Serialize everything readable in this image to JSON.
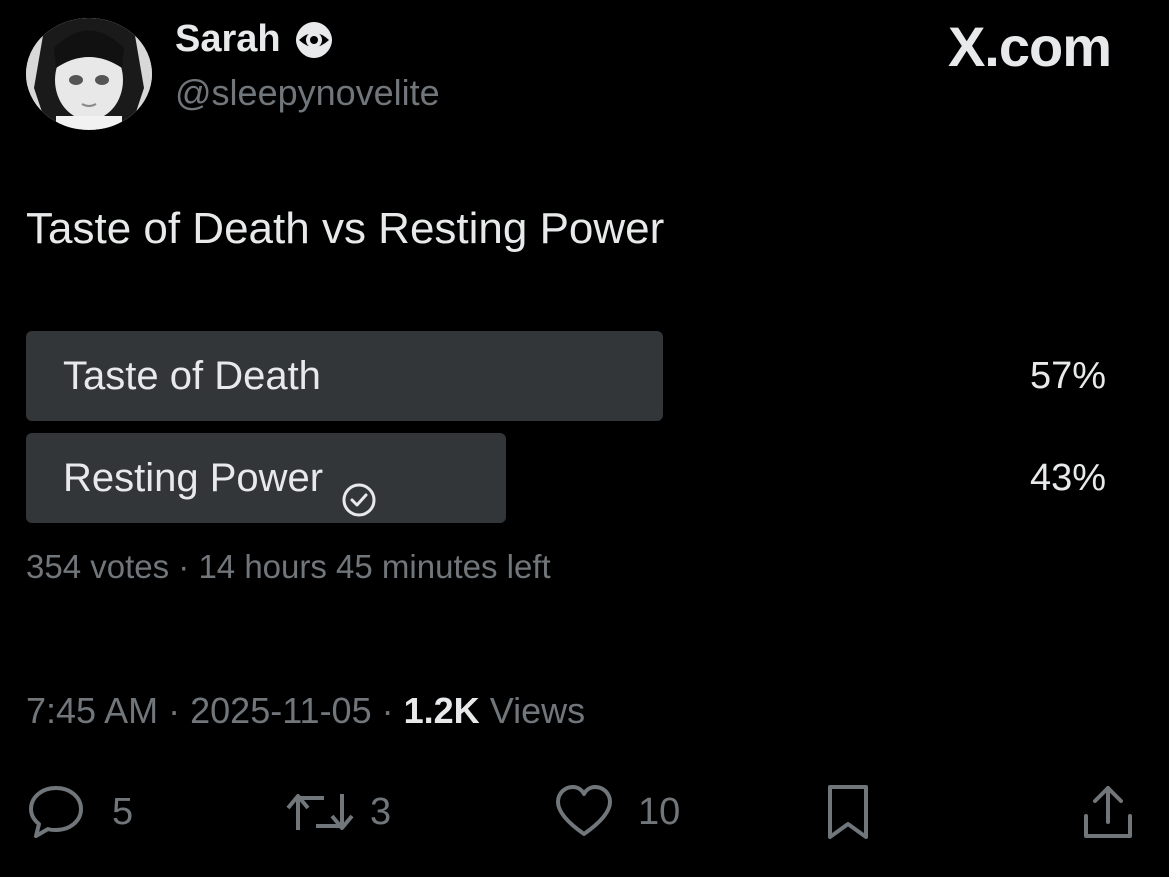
{
  "author": {
    "display_name": "Sarah",
    "handle": "@sleepynovelite",
    "badge_icon": "eye-badge-icon",
    "avatar": "anime-avatar"
  },
  "brand": "X.com",
  "post": {
    "text": "Taste of Death vs Resting Power"
  },
  "poll": {
    "options": [
      {
        "label": "Taste of Death",
        "percent": "57%",
        "value": 57,
        "selected": false
      },
      {
        "label": "Resting Power",
        "percent": "43%",
        "value": 43,
        "selected": true
      }
    ],
    "votes": "354 votes",
    "separator": "·",
    "time_left": "14 hours 45 minutes left"
  },
  "meta": {
    "time": "7:45 AM",
    "date": "2025-11-05",
    "views_count": "1.2K",
    "views_label": "Views",
    "separator": "·"
  },
  "actions": {
    "reply_count": "5",
    "repost_count": "3",
    "like_count": "10"
  },
  "colors": {
    "background": "#000000",
    "text": "#e7e9ea",
    "secondary": "#71767b",
    "poll_bar": "#333639"
  }
}
